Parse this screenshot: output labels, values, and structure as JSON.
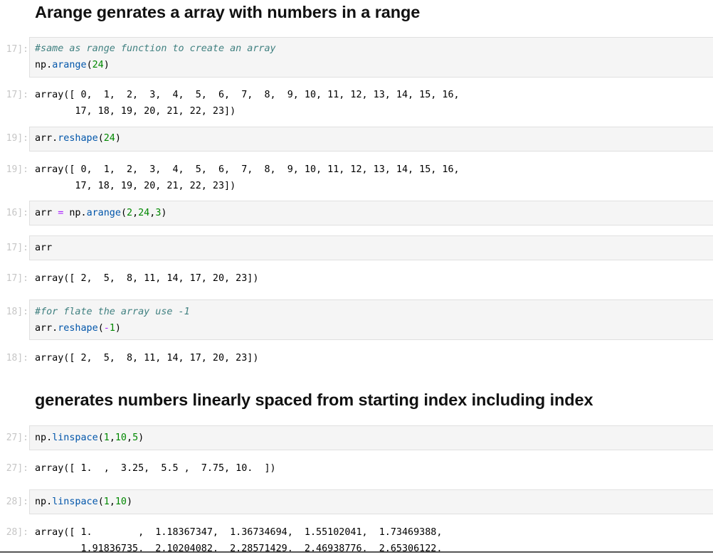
{
  "headings": {
    "arange": "Arange genrates a array with numbers in a range",
    "linspace": "generates numbers linearly spaced from starting index including index"
  },
  "cells": [
    {
      "in_prompt": "17]:",
      "code": {
        "comment": "#same as range function to create an array",
        "obj": "np.",
        "func": "arange",
        "open": "(",
        "arg": "24",
        "close": ")"
      },
      "out_prompt": "17]:",
      "output": "array([ 0,  1,  2,  3,  4,  5,  6,  7,  8,  9, 10, 11, 12, 13, 14, 15, 16,\n       17, 18, 19, 20, 21, 22, 23])"
    },
    {
      "in_prompt": "19]:",
      "code": {
        "obj": "arr.",
        "func": "reshape",
        "open": "(",
        "arg": "24",
        "close": ")"
      },
      "out_prompt": "19]:",
      "output": "array([ 0,  1,  2,  3,  4,  5,  6,  7,  8,  9, 10, 11, 12, 13, 14, 15, 16,\n       17, 18, 19, 20, 21, 22, 23])"
    },
    {
      "in_prompt": "16]:",
      "code": {
        "lhs": "arr ",
        "eq": "=",
        "obj": " np.",
        "func": "arange",
        "open": "(",
        "a1": "2",
        "s1": ",",
        "a2": "24",
        "s2": ",",
        "a3": "3",
        "close": ")"
      }
    },
    {
      "in_prompt": "17]:",
      "code": {
        "text": "arr"
      },
      "out_prompt": "17]:",
      "output": "array([ 2,  5,  8, 11, 14, 17, 20, 23])"
    },
    {
      "in_prompt": "18]:",
      "code": {
        "comment": "#for flate the array use -1",
        "obj": "arr.",
        "func": "reshape",
        "open": "(",
        "minus": "-",
        "arg": "1",
        "close": ")"
      },
      "out_prompt": "18]:",
      "output": "array([ 2,  5,  8, 11, 14, 17, 20, 23])"
    },
    {
      "in_prompt": "27]:",
      "code": {
        "obj": "np.",
        "func": "linspace",
        "open": "(",
        "a1": "1",
        "s1": ",",
        "a2": "10",
        "s2": ",",
        "a3": "5",
        "close": ")"
      },
      "out_prompt": "27]:",
      "output": "array([ 1.  ,  3.25,  5.5 ,  7.75, 10.  ])"
    },
    {
      "in_prompt": "28]:",
      "code": {
        "obj": "np.",
        "func": "linspace",
        "open": "(",
        "a1": "1",
        "s1": ",",
        "a2": "10",
        "close": ")"
      },
      "out_prompt": "28]:",
      "output": "array([ 1.        ,  1.18367347,  1.36734694,  1.55102041,  1.73469388,\n        1.91836735,  2.10204082,  2.28571429,  2.46938776,  2.65306122,"
    }
  ]
}
